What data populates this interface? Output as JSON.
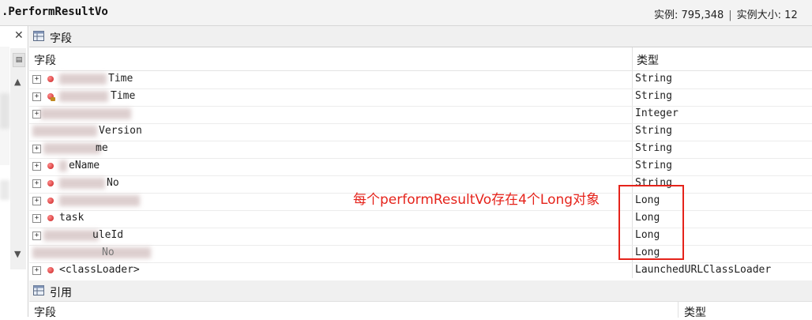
{
  "header": {
    "class_name": ".PerformResultVo",
    "instances_label": "实例: 795,348",
    "separator": "|",
    "instance_size_label": "实例大小: 12"
  },
  "left_panel": {
    "close_glyph": "✕",
    "scroll_up": "▲",
    "scroll_down": "▼",
    "grip_glyph": "▤"
  },
  "fields_section": {
    "title": "字段",
    "columns": [
      "字段",
      "类型"
    ],
    "rows": [
      {
        "name": "  ...Time",
        "visible_name": "Time",
        "type": "String"
      },
      {
        "name": "...Time",
        "visible_name": "Time",
        "type": "String"
      },
      {
        "name": "",
        "visible_name": "",
        "type": "Integer"
      },
      {
        "name": "...Version",
        "visible_name": "Version",
        "type": "String"
      },
      {
        "name": "...me",
        "visible_name": "me",
        "type": "String"
      },
      {
        "name": "...eName",
        "visible_name": "eName",
        "type": "String"
      },
      {
        "name": "...No",
        "visible_name": "No",
        "type": "String"
      },
      {
        "name": "",
        "visible_name": "",
        "type": "Long"
      },
      {
        "name": "task",
        "visible_name": "task",
        "type": "Long"
      },
      {
        "name": "...uleId",
        "visible_name": "uleId",
        "type": "Long"
      },
      {
        "name": "...No",
        "visible_name": "No",
        "type": "Long"
      },
      {
        "name": "<classLoader>",
        "visible_name": "<classLoader>",
        "type": "LaunchedURLClassLoader"
      }
    ]
  },
  "annotation": {
    "text": "每个performResultVo存在4个Long对象",
    "color": "#e5231b"
  },
  "references_section": {
    "title": "引用",
    "columns": [
      "字段",
      "类型"
    ]
  }
}
